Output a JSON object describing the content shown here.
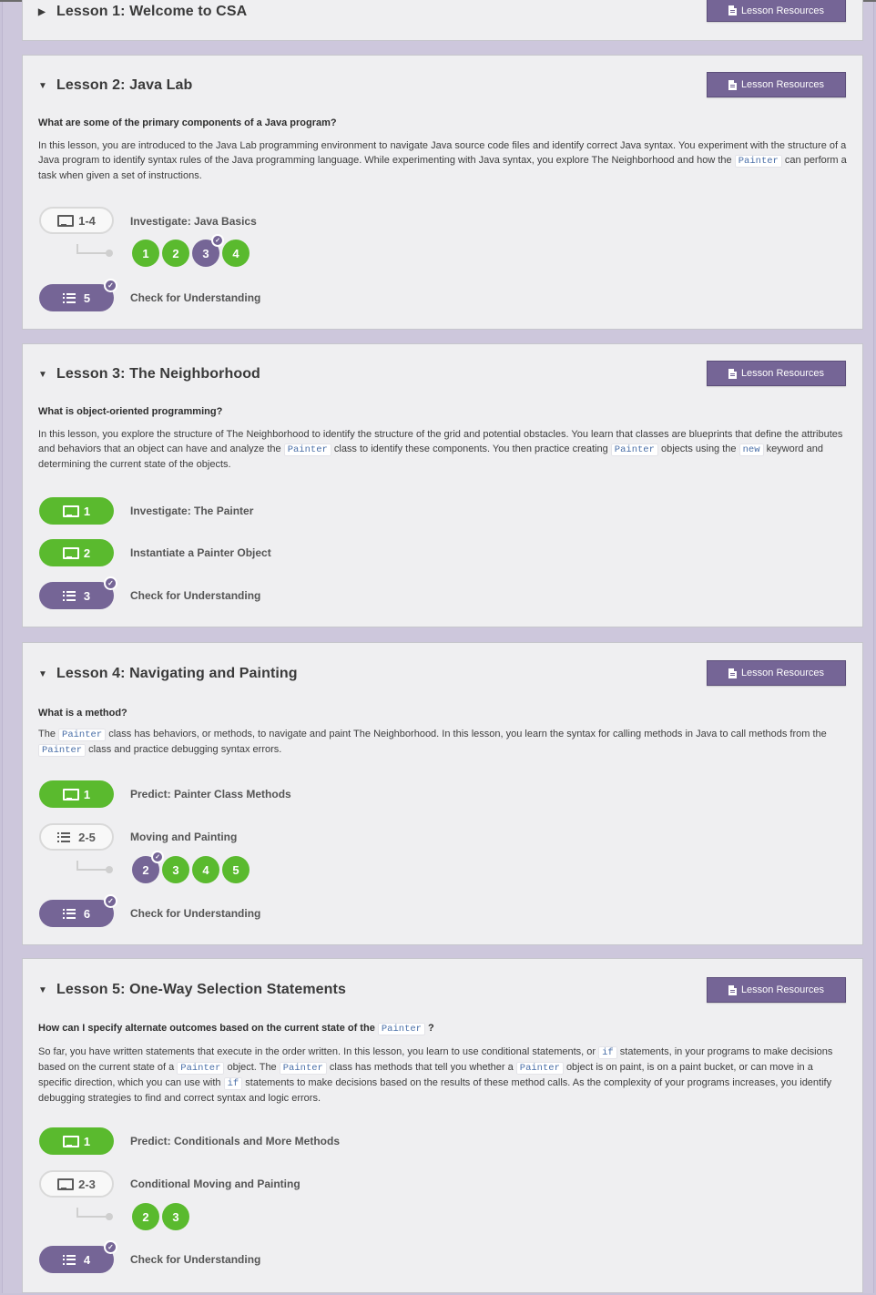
{
  "lessons": [
    {
      "title": "Lesson 1: Welcome to CSA",
      "expanded": false,
      "resources_label": "Lesson Resources"
    },
    {
      "title": "Lesson 2: Java Lab",
      "expanded": true,
      "resources_label": "Lesson Resources",
      "question": "What are some of the primary components of a Java program?",
      "description": {
        "p1": "In this lesson, you are introduced to the Java Lab programming environment to navigate Java source code files and identify correct Java syntax. You experiment with the structure of a Java program to identify syntax rules of the Java programming language. While experimenting with Java syntax, you explore The Neighborhood and how the",
        "c1": "Painter",
        "p2": "can perform a task when given a set of instructions."
      },
      "activities": [
        {
          "icon": "monitor-icon",
          "badge": "1-4",
          "label": "Investigate: Java Basics",
          "style": "white",
          "sublevels": [
            {
              "num": "1",
              "status": "green"
            },
            {
              "num": "2",
              "status": "green"
            },
            {
              "num": "3",
              "status": "purple",
              "checked": true
            },
            {
              "num": "4",
              "status": "green"
            }
          ]
        },
        {
          "icon": "list-icon",
          "badge": "5",
          "label": "Check for Understanding",
          "style": "purple",
          "checked": true
        }
      ]
    },
    {
      "title": "Lesson 3: The Neighborhood",
      "expanded": true,
      "resources_label": "Lesson Resources",
      "question": "What is object-oriented programming?",
      "description": {
        "p1": "In this lesson, you explore the structure of The Neighborhood to identify the structure of the grid and potential obstacles. You learn that classes are blueprints that define the attributes and behaviors that an object can have and analyze the",
        "c1": "Painter",
        "p2": "class to identify these components. You then practice creating",
        "c2": "Painter",
        "p3": "objects using the",
        "c3": "new",
        "p4": "keyword and determining the current state of the objects."
      },
      "activities": [
        {
          "icon": "monitor-icon",
          "badge": "1",
          "label": "Investigate: The Painter",
          "style": "green"
        },
        {
          "icon": "monitor-icon",
          "badge": "2",
          "label": "Instantiate a Painter Object",
          "style": "green"
        },
        {
          "icon": "list-icon",
          "badge": "3",
          "label": "Check for Understanding",
          "style": "purple",
          "checked": true
        }
      ]
    },
    {
      "title": "Lesson 4: Navigating and Painting",
      "expanded": true,
      "resources_label": "Lesson Resources",
      "question": "What is a method?",
      "description": {
        "p1": "The",
        "c1": "Painter",
        "p2": "class has behaviors, or methods, to navigate and paint The Neighborhood. In this lesson, you learn the syntax for calling methods in Java to call methods from the",
        "c2": "Painter",
        "p3": "class and practice debugging syntax errors."
      },
      "activities": [
        {
          "icon": "monitor-icon",
          "badge": "1",
          "label": "Predict: Painter Class Methods",
          "style": "green"
        },
        {
          "icon": "list-icon",
          "badge": "2-5",
          "label": "Moving and Painting",
          "style": "white",
          "sublevels": [
            {
              "num": "2",
              "status": "purple",
              "checked": true
            },
            {
              "num": "3",
              "status": "green"
            },
            {
              "num": "4",
              "status": "green"
            },
            {
              "num": "5",
              "status": "green"
            }
          ]
        },
        {
          "icon": "list-icon",
          "badge": "6",
          "label": "Check for Understanding",
          "style": "purple",
          "checked": true
        }
      ]
    },
    {
      "title": "Lesson 5: One-Way Selection Statements",
      "expanded": true,
      "resources_label": "Lesson Resources",
      "question_a": "How can I specify alternate outcomes based on the current state of the",
      "question_code": "Painter",
      "question_b": "?",
      "description": {
        "p1": "So far, you have written statements that execute in the order written. In this lesson, you learn to use conditional statements, or",
        "c1": "if",
        "p2": "statements, in your programs to make decisions based on the current state of a",
        "c2": "Painter",
        "p3": "object. The",
        "c3": "Painter",
        "p4": "class has methods that tell you whether a",
        "c4": "Painter",
        "p5": "object is on paint, is on a paint bucket, or can move in a specific direction, which you can use with",
        "c5": "if",
        "p6": "statements to make decisions based on the results of these method calls. As the complexity of your programs increases, you identify debugging strategies to find and correct syntax and logic errors."
      },
      "activities": [
        {
          "icon": "monitor-icon",
          "badge": "1",
          "label": "Predict: Conditionals and More Methods",
          "style": "green"
        },
        {
          "icon": "monitor-icon",
          "badge": "2-3",
          "label": "Conditional Moving and Painting",
          "style": "white",
          "sublevels": [
            {
              "num": "2",
              "status": "green"
            },
            {
              "num": "3",
              "status": "green"
            }
          ]
        },
        {
          "icon": "list-icon",
          "badge": "4",
          "label": "Check for Understanding",
          "style": "purple",
          "checked": true
        }
      ]
    }
  ],
  "check_glyph": "✓",
  "caret_right": "▶",
  "caret_down": "▼",
  "colors": {
    "completed": "#5aba2e",
    "assessment": "#756596",
    "not_started": "#f8f8f8"
  }
}
